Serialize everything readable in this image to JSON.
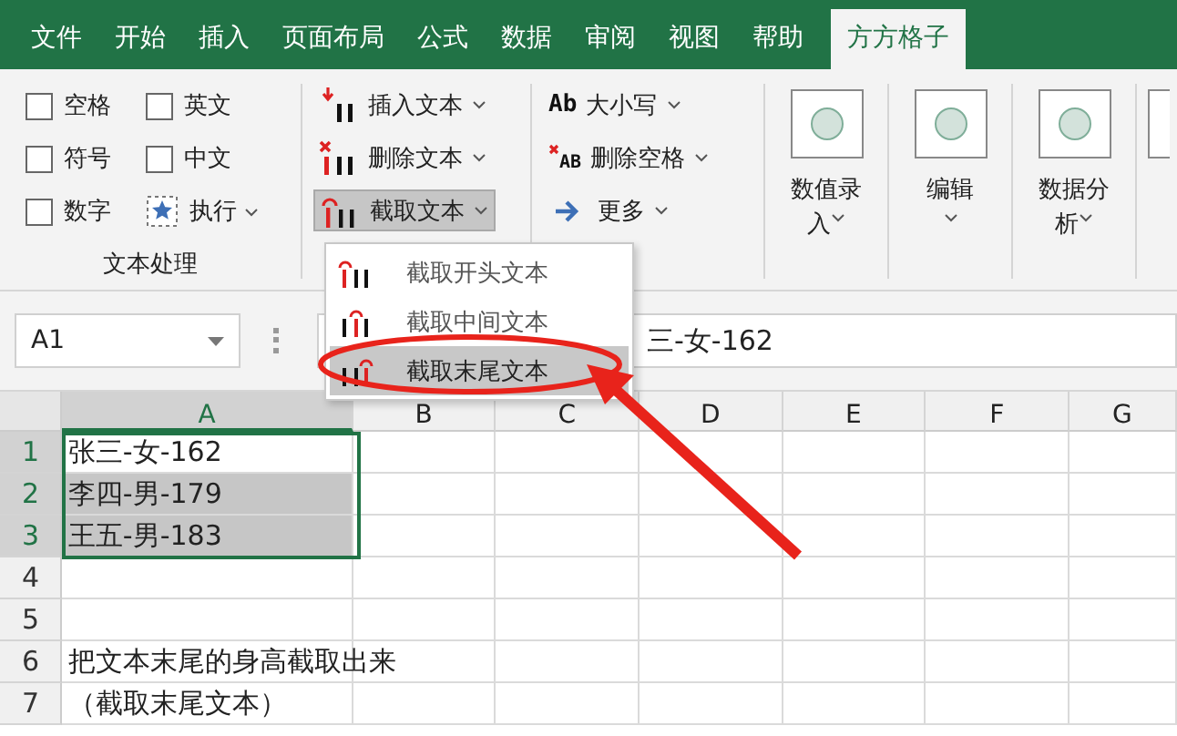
{
  "tabs": [
    {
      "label": "文件",
      "selected": false
    },
    {
      "label": "开始",
      "selected": false
    },
    {
      "label": "插入",
      "selected": false
    },
    {
      "label": "页面布局",
      "selected": false
    },
    {
      "label": "公式",
      "selected": false
    },
    {
      "label": "数据",
      "selected": false
    },
    {
      "label": "审阅",
      "selected": false
    },
    {
      "label": "视图",
      "selected": false
    },
    {
      "label": "帮助",
      "selected": false
    },
    {
      "label": "方方格子",
      "selected": true
    }
  ],
  "ribbon": {
    "text_group": {
      "checkboxes": [
        {
          "label": "空格",
          "checked": false
        },
        {
          "label": "英文",
          "checked": false
        },
        {
          "label": "符号",
          "checked": false
        },
        {
          "label": "中文",
          "checked": false
        },
        {
          "label": "数字",
          "checked": false
        }
      ],
      "execute_button": "执行",
      "label": "文本处理"
    },
    "text_tools": [
      {
        "kind": "insert",
        "label": "插入文本",
        "selected": false
      },
      {
        "kind": "delete",
        "label": "删除文本",
        "selected": false
      },
      {
        "kind": "extract",
        "label": "截取文本",
        "selected": true
      }
    ],
    "more_tools": [
      {
        "kind": "case",
        "icon": "Ab",
        "label": "大小写"
      },
      {
        "kind": "remove-space",
        "icon": "AB",
        "label": "删除空格"
      },
      {
        "kind": "more",
        "label": "更多"
      }
    ],
    "big_buttons": [
      {
        "line_1": "数值录",
        "line_2": "入"
      },
      {
        "line_1": "编辑"
      },
      {
        "line_1": "数据分",
        "line_2": "析"
      }
    ]
  },
  "dropdown_menu": [
    {
      "kind": "start",
      "label": "截取开头文本",
      "selected": false
    },
    {
      "kind": "middle",
      "label": "截取中间文本",
      "selected": false
    },
    {
      "kind": "end",
      "label": "截取末尾文本",
      "selected": true
    }
  ],
  "name_box": "A1",
  "formula": "三-女-162",
  "columns": [
    {
      "label": "A",
      "selected": true
    },
    {
      "label": "B",
      "selected": false
    },
    {
      "label": "C",
      "selected": false
    },
    {
      "label": "D",
      "selected": false
    },
    {
      "label": "E",
      "selected": false
    },
    {
      "label": "F",
      "selected": false
    },
    {
      "label": "G",
      "selected": false
    }
  ],
  "rows": [
    {
      "label": "1",
      "cell": "张三-女-162",
      "selected": true,
      "active": true
    },
    {
      "label": "2",
      "cell": "李四-男-179",
      "selected": true
    },
    {
      "label": "3",
      "cell": "王五-男-183",
      "selected": true
    },
    {
      "label": "4",
      "selected": false
    },
    {
      "label": "5",
      "selected": false
    },
    {
      "label": "6",
      "cell": "把文本末尾的身高截取出来",
      "selected": false
    },
    {
      "label": "7",
      "cell": "（截取末尾文本）",
      "selected": false
    }
  ]
}
